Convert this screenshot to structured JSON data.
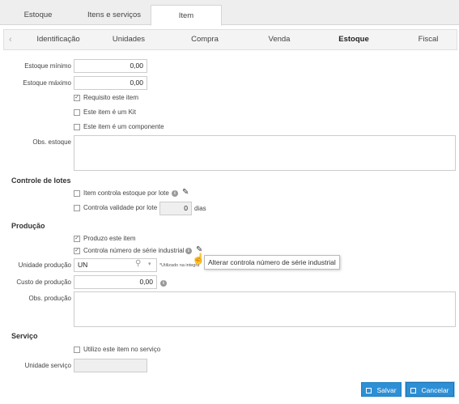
{
  "top_tabs": [
    "Estoque",
    "Itens e serviços",
    "Item"
  ],
  "sub_tabs": [
    "Identificação",
    "Unidades",
    "Compra",
    "Venda",
    "Estoque",
    "Fiscal"
  ],
  "estoque": {
    "minimo_label": "Estoque mínimo",
    "minimo_value": "0,00",
    "maximo_label": "Estoque máximo",
    "maximo_value": "0,00",
    "requisito_label": "Requisito este item",
    "requisito_checked": true,
    "kit_label": "Este item é um Kit",
    "componente_label": "Este item é um componente",
    "obs_label": "Obs. estoque"
  },
  "lotes": {
    "title": "Controle de lotes",
    "controla_lote_label": "Item controla estoque por lote",
    "validade_label": "Controla validade por lote",
    "validade_value": "0",
    "dias_label": "dias"
  },
  "producao": {
    "title": "Produção",
    "produzo_label": "Produzo este item",
    "serie_label": "Controla número de série industrial",
    "unidade_label": "Unidade produção",
    "unidade_value": "UN",
    "utilizado_note": "*Utilizado na integra",
    "custo_label": "Custo de produção",
    "custo_value": "0,00",
    "obs_label": "Obs. produção",
    "tooltip": "Alterar controla número de série industrial"
  },
  "servico": {
    "title": "Serviço",
    "utilizo_label": "Utilizo este item no serviço",
    "unidade_label": "Unidade serviço"
  },
  "buttons": {
    "save": "Salvar",
    "cancel": "Cancelar"
  }
}
